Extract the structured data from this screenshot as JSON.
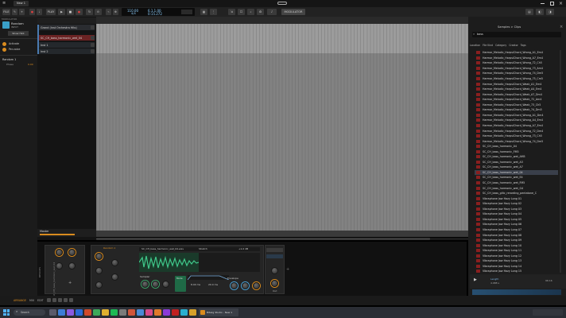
{
  "window": {
    "project_tab": "New 1"
  },
  "toolbar": {
    "file_label": "FILE",
    "play_label": "PLAY",
    "tempo": "110.00",
    "time_sig": "4/4",
    "position": "6.1.1.00",
    "time": "0:15.272",
    "modulator_label": "MODULATOR"
  },
  "inspector": {
    "header": "MODULATOR",
    "device_name": "Random",
    "device_sub": "INPUT",
    "show_btn": "Show Hint",
    "edit_label": "Activate",
    "row2": "Per-voice",
    "random_label": "Random 1",
    "random_param": "Phase",
    "random_value": "0.00"
  },
  "tracks": [
    {
      "name": "Grand (Inst Orchestra Hits)",
      "color": "#3b3f44"
    },
    {
      "name": "SC_CH_bass_harmonic_wet_04",
      "color": "#8a2e2e"
    },
    {
      "name": "Inst 1",
      "color": "#5a2a8a"
    },
    {
      "name": "Inst 2",
      "color": "#2a5a8a"
    }
  ],
  "master_track": "Master",
  "browser": {
    "title": "Samples > Clips",
    "search_value": "bass",
    "tabs": [
      "Location",
      "File Kind",
      "Category",
      "Creator",
      "Tags"
    ],
    "items": [
      "Harmor_Melodic_HarpsiChord_Wrong_A1_Em4",
      "Harmor_Melodic_HarpsiChord_Wrong_A7_Em4",
      "Harmor_Melodic_HarpsiChord_Wrong_72_Ch5",
      "Harmor_Melodic_HarpsiChord_Wrong_73_Am4",
      "Harmor_Melodic_HarpsiChord_Wrong_74_Dm5",
      "Harmor_Melodic_HarpsiChord_Wrong_75_Cm5",
      "Harmor_Melodic_HarpsiChord_Weak_A1_Em4",
      "Harmor_Melodic_HarpsiChord_Weak_A4_Em4",
      "Harmor_Melodic_HarpsiChord_Weak_A7_Dm4",
      "Harmor_Melodic_HarpsiChord_Weak_72_Am4",
      "Harmor_Melodic_HarpsiChord_Weak_73_Ch5",
      "Harmor_Melodic_HarpsiChord_Weak_74_Dm5",
      "Harmor_Melodic_HarpsiChord_Wrong_A1_Dm4",
      "Harmor_Melodic_HarpsiChord_Wrong_A4_Em4",
      "Harmor_Melodic_HarpsiChord_Wrong_A7_Em4",
      "Harmor_Melodic_HarpsiChord_Wrong_72_Dm4",
      "Harmor_Melodic_HarpsiChord_Wrong_73_Ch5",
      "Harmor_Melodic_HarpsiChord_Wrong_74_Dm5",
      "SC_CH_bass_harmonic_04",
      "SC_CH_bass_harmonic_FM5",
      "SC_CH_bass_harmonic_wet_AM5",
      "SC_CH_bass_harmonic_wet_A3",
      "SC_CH_bass_harmonic_wet_A7",
      "SC_CH_bass_harmonic_wet_04",
      "SC_CH_bass_harmonic_wet_E4",
      "SC_CH_bass_harmonic_wet_FM5",
      "SC_CH_bass_harmonic_wet_G4",
      "SC_CH_bass_glitc_rerording_pentatone_C",
      "Vibraphone Jaw Hazy Long 01",
      "Vibraphone Jaw Hazy Long 02",
      "Vibraphone Jaw Hazy Long 03",
      "Vibraphone Jaw Hazy Long 04",
      "Vibraphone Jaw Hazy Long 05",
      "Vibraphone Jaw Hazy Long 06",
      "Vibraphone Jaw Hazy Long 07",
      "Vibraphone Jaw Hazy Long 08",
      "Vibraphone Jaw Hazy Long 09",
      "Vibraphone Jaw Hazy Long 10",
      "Vibraphone Jaw Hazy Long 11",
      "Vibraphone Jaw Hazy Long 12",
      "Vibraphone Jaw Hazy Long 13",
      "Vibraphone Jaw Hazy Long 14",
      "Vibraphone Jaw Hazy Long 15",
      "Vibraphone Jaw Hazy Long 16"
    ],
    "selected_index": 23,
    "footer_label": "Length",
    "footer_value": "4.988 s",
    "footer_right": "96:16"
  },
  "device": {
    "chain_label": "DEVICES",
    "panel_label": "SC_CH_bass_harmonic_wet_04",
    "clip_name": "SC_CH_bass_harmonic_wet_04.wav",
    "field1": "138 %",
    "field2": "Stretch",
    "field3": "0.0",
    "field4": "0 cents",
    "field5": "+1.0 dB",
    "random_label": "Random 1",
    "knob_labels": [
      "Speed",
      "Grain",
      "Motion",
      "Gain",
      "Mix",
      "Filter",
      "Amp"
    ],
    "sampler_label": "Sampler",
    "envelope_label": "Envelope",
    "mode_label": "Mode",
    "amp_value": "8.00 ms",
    "rel_value": "20.0 ms",
    "out_label": "Out"
  },
  "statusbar": {
    "arrange": "ARRANGE",
    "mix": "MIX",
    "edit": "EDIT"
  },
  "taskbar": {
    "search_placeholder": "Search",
    "app_label": "Bitwig Studio - New 1"
  }
}
